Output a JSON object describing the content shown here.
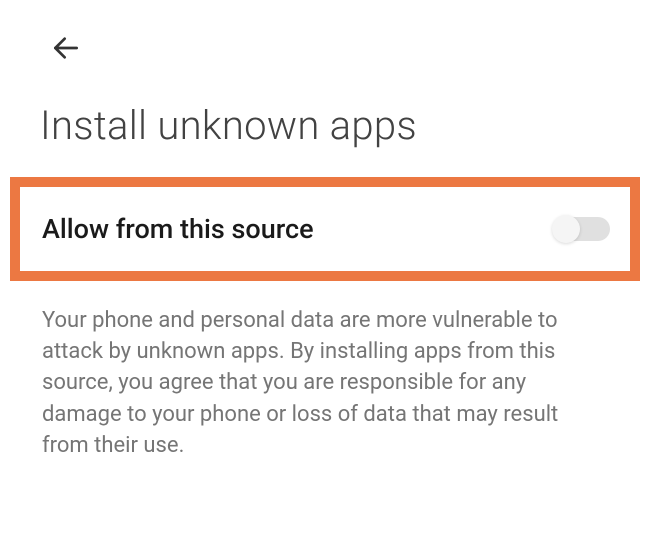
{
  "header": {
    "title": "Install unknown apps"
  },
  "setting": {
    "label": "Allow from this source",
    "toggle_state": "off"
  },
  "description": {
    "text": "Your phone and personal data are more vulnerable to attack by unknown apps. By installing apps from this source, you agree that you are responsible for any damage to your phone or loss of data that may result from their use."
  }
}
